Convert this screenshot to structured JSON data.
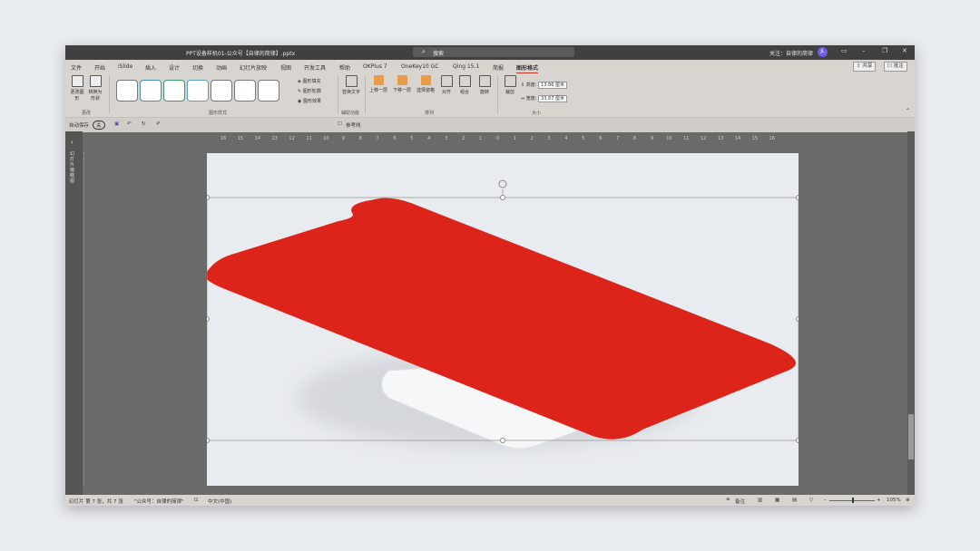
{
  "titlebar": {
    "doc_title": "PPT设备样机01-公众号【自律的简律】.pptx",
    "search_label": "搜索",
    "user": "关注：自律的简律",
    "avatar": "JL"
  },
  "ribbon_tabs": [
    "文件",
    "开始",
    "iSlide",
    "插入",
    "设计",
    "切换",
    "动画",
    "幻灯片放映",
    "视图",
    "开发工具",
    "帮助",
    "OKPlus 7",
    "OneKey10 GC",
    "Qing 15.1",
    "简报",
    "图形格式"
  ],
  "active_tab": "图形格式",
  "share_label": "共享",
  "comment_label": "批注",
  "ribbon": {
    "change_shape": "更改图形",
    "convert_shape": "转换为形状",
    "group_change": "更改",
    "shape_fill": "图形填充",
    "shape_outline": "图形轮廓",
    "shape_effects": "图形效果",
    "group_styles": "图形样式",
    "alt_text": "替换文字",
    "group_accessibility": "辅助功能",
    "bring_forward": "上移一层",
    "send_backward": "下移一层",
    "selection_pane": "选择窗格",
    "align": "对齐",
    "group": "组合",
    "rotate": "旋转",
    "group_arrange": "排列",
    "crop": "裁剪",
    "height_label": "高度:",
    "height_value": "13.86 厘米",
    "width_label": "宽度:",
    "width_value": "33.87 厘米",
    "group_size": "大小"
  },
  "qat": {
    "autosave": "自动保存",
    "toggle": "关",
    "reference_line": "参考线"
  },
  "ruler_ticks": [
    "16",
    "15",
    "14",
    "13",
    "12",
    "11",
    "10",
    "9",
    "8",
    "7",
    "6",
    "5",
    "4",
    "3",
    "2",
    "1",
    "0",
    "1",
    "2",
    "3",
    "4",
    "5",
    "6",
    "7",
    "8",
    "9",
    "10",
    "11",
    "12",
    "13",
    "14",
    "15",
    "16"
  ],
  "left_pane_label": "幻灯片缩略图",
  "status": {
    "slide_info": "幻灯片 第 7 张，共 7 张",
    "template": "\"公众号：自律的简律\"",
    "language": "中文(中国)",
    "notes": "备注",
    "zoom": "105%"
  },
  "colors": {
    "accent_red": "#dc241b",
    "ribbon_bg": "#d8d4d0",
    "titlebar_bg": "#404040"
  }
}
